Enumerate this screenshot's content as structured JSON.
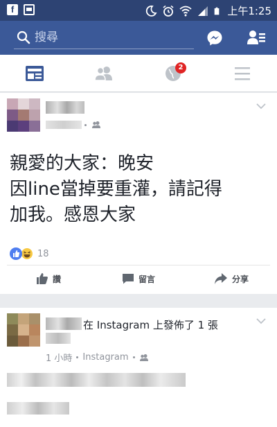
{
  "status_bar": {
    "time": "上午1:25",
    "app_icon": "facebook-icon",
    "icons": [
      "moon-icon",
      "alarm-icon",
      "wifi-icon",
      "battery-icon"
    ]
  },
  "search": {
    "placeholder": "搜尋"
  },
  "tabs": [
    {
      "name": "news-feed",
      "icon": "news-feed-icon",
      "active": true
    },
    {
      "name": "friends",
      "icon": "friends-icon",
      "active": false
    },
    {
      "name": "notifications",
      "icon": "globe-icon",
      "badge": "2",
      "active": false
    },
    {
      "name": "menu",
      "icon": "menu-icon",
      "active": false
    }
  ],
  "post1": {
    "text_lines": [
      "親愛的大家：晚安",
      "因line當掉要重灌，請記得",
      "加我。感恩大家"
    ],
    "reaction_count": "18",
    "actions": {
      "like": "讚",
      "comment": "留言",
      "share": "分享"
    }
  },
  "post2": {
    "byline": "在 Instagram 上發佈了 1 張",
    "time": "1 小時",
    "source": "Instagram"
  },
  "colors": {
    "brand": "#3b5998",
    "status_bar": "#2d4373",
    "badge": "#e02424",
    "active_tab": "#3b5998"
  }
}
